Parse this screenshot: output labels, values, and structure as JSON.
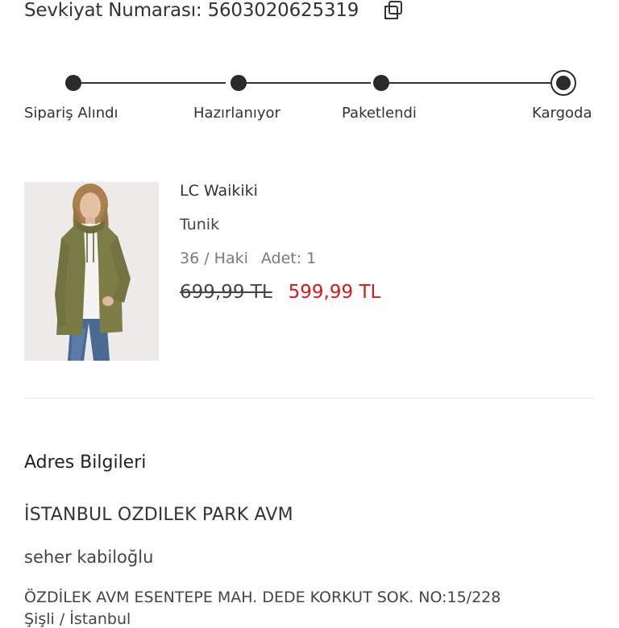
{
  "shipment": {
    "label": "Sevkiyat Numarası: 5603020625319",
    "copy_icon": "copy-icon"
  },
  "tracker": {
    "steps": [
      {
        "label": "Sipariş Alındı",
        "done": true
      },
      {
        "label": "Hazırlanıyor",
        "done": true
      },
      {
        "label": "Paketlendi",
        "done": true
      },
      {
        "label": "Kargoda",
        "current": true
      }
    ]
  },
  "product": {
    "brand": "LC Waikiki",
    "name": "Tunik",
    "size_color": "36 / Haki",
    "quantity": "Adet: 1",
    "old_price": "699,99 TL",
    "new_price": "599,99 TL"
  },
  "address": {
    "title": "Adres Bilgileri",
    "store": "İSTANBUL OZDILEK PARK AVM",
    "name": "seher kabiloğlu",
    "line1": "ÖZDİLEK AVM ESENTEPE MAH. DEDE KORKUT SOK. NO:15/228",
    "line2": "Şişli / İstanbul"
  },
  "colors": {
    "text": "#333333",
    "price_discount": "#d11a1a",
    "muted": "#7a7a7a",
    "divider": "#e6e6e6"
  }
}
